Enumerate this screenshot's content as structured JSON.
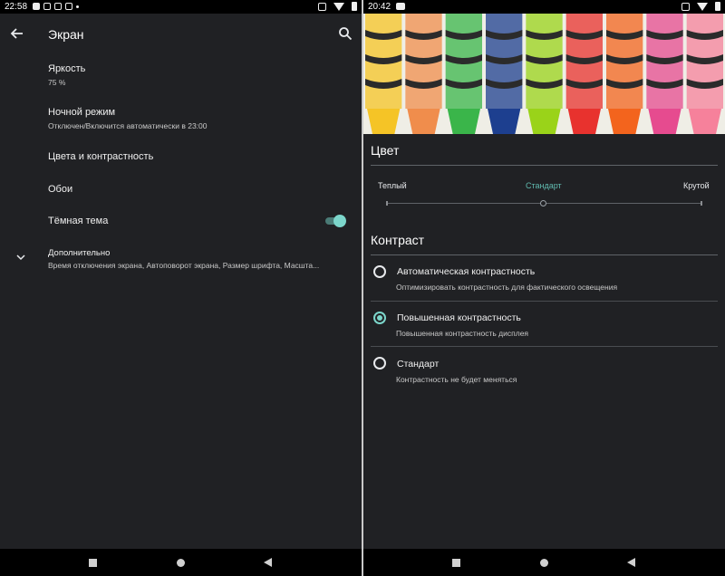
{
  "left": {
    "status_time": "22:58",
    "title": "Экран",
    "items": [
      {
        "title": "Яркость",
        "subtitle": "75 %"
      },
      {
        "title": "Ночной режим",
        "subtitle": "Отключен/Включится автоматически в 23:00"
      },
      {
        "title": "Цвета и контрастность"
      },
      {
        "title": "Обои"
      },
      {
        "title": "Тёмная тема",
        "toggle_on": true
      },
      {
        "title": "Дополнительно",
        "subtitle": "Время отключения экрана, Автоповорот экрана, Размер шрифта, Масшта..."
      }
    ]
  },
  "right": {
    "status_time": "20:42",
    "color_section": "Цвет",
    "color_options": [
      "Теплый",
      "Стандарт",
      "Крутой"
    ],
    "color_selected": "Стандарт",
    "contrast_section": "Контраст",
    "contrast_options": [
      {
        "title": "Автоматическая контрастность",
        "subtitle": "Оптимизировать контрастность для фактического освещения",
        "checked": false
      },
      {
        "title": "Повышенная контрастность",
        "subtitle": "Повышенная контрастность дисплея",
        "checked": true
      },
      {
        "title": "Стандарт",
        "subtitle": "Контрастность не будет меняться",
        "checked": false
      }
    ]
  },
  "colors": {
    "background": "#202124",
    "accent": "#7cd6cb",
    "accent_text": "#60bbb0",
    "crayons": [
      "#f5c426",
      "#f08d4c",
      "#3ab54a",
      "#1d3f8f",
      "#9ad319",
      "#e8322e",
      "#f3641d",
      "#e64b8f",
      "#f6819b"
    ]
  },
  "icons": [
    "back-arrow-icon",
    "search-icon",
    "chevron-down-icon",
    "wifi-icon",
    "battery-icon",
    "vibrate-icon"
  ]
}
